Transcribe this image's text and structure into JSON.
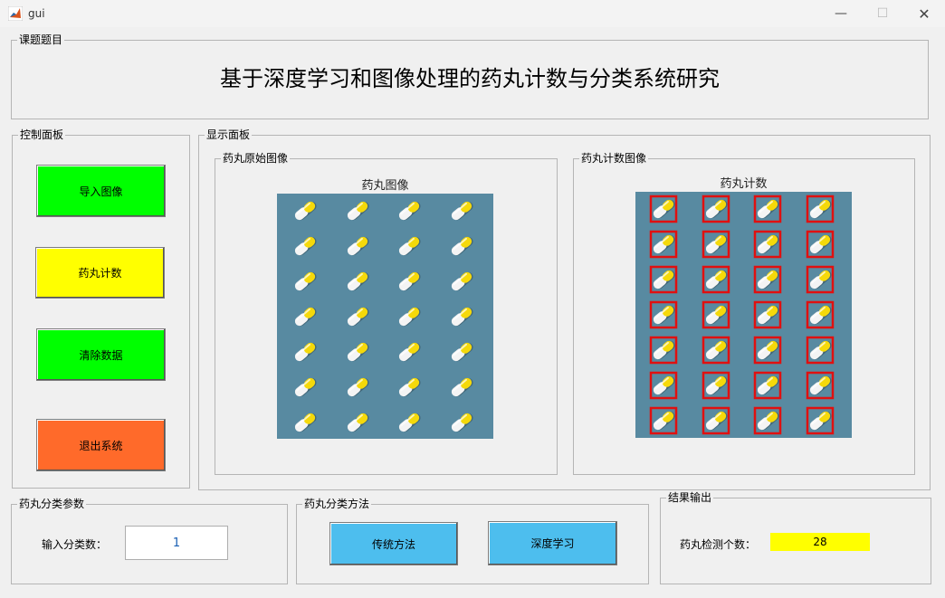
{
  "window": {
    "title": "gui"
  },
  "title_panel": {
    "label": "课题题目",
    "title": "基于深度学习和图像处理的药丸计数与分类系统研究"
  },
  "control_panel": {
    "label": "控制面板",
    "buttons": [
      {
        "label": "导入图像",
        "color": "#00ff00"
      },
      {
        "label": "药丸计数",
        "color": "#ffff00"
      },
      {
        "label": "清除数据",
        "color": "#00ff00"
      },
      {
        "label": "退出系统",
        "color": "#ff6a2a"
      }
    ]
  },
  "display_panel": {
    "label": "显示面板",
    "original": {
      "label": "药丸原始图像",
      "axes_title": "药丸图像"
    },
    "counted": {
      "label": "药丸计数图像",
      "axes_title": "药丸计数"
    },
    "grid": {
      "rows": 7,
      "cols": 4
    },
    "colors": {
      "background": "#588aa1",
      "pill_yellow": "#f5d90a",
      "pill_white": "#f4f4f4",
      "box": "#e01010"
    }
  },
  "params_panel": {
    "label": "药丸分类参数",
    "input_label": "输入分类数：",
    "input_value": "1"
  },
  "method_panel": {
    "label": "药丸分类方法",
    "buttons": [
      {
        "label": "传统方法",
        "color": "#4dbeee"
      },
      {
        "label": "深度学习",
        "color": "#4dbeee"
      }
    ]
  },
  "result_panel": {
    "label": "结果输出",
    "count_label": "药丸检测个数：",
    "count_value": "28",
    "value_bg": "#ffff00"
  }
}
